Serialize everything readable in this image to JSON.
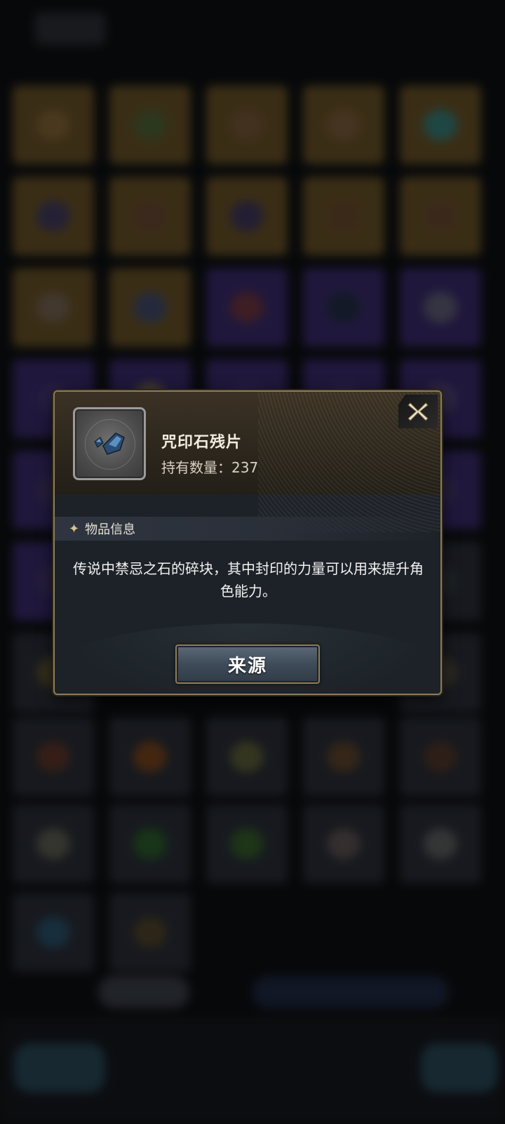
{
  "dialog": {
    "item_name": "咒印石残片",
    "item_count_label": "持有数量：237",
    "section_label": "物品信息",
    "description": "传说中禁忌之石的碎块，其中封印的力量可以用来提升角色能力。",
    "source_button_label": "来源",
    "close_icon": "close-icon",
    "item_icon": "blue-crystal-shard-icon"
  },
  "colors": {
    "frame_gold": "#8e7c58",
    "dialog_bg": "#1d2229",
    "button_blue": "#3e4b58",
    "header_brown": "#2c261c"
  }
}
